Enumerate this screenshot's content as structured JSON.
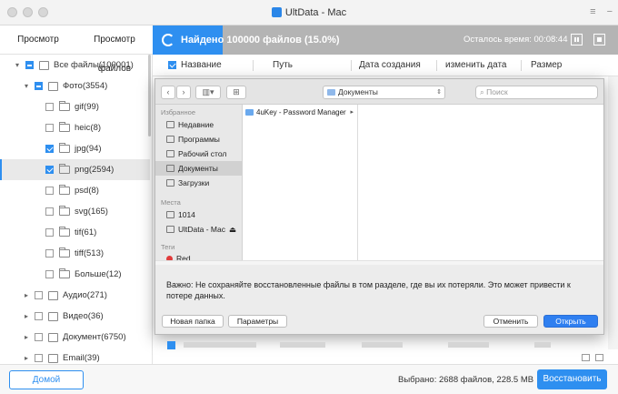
{
  "window": {
    "title": "UltData - Mac"
  },
  "tabs": [
    {
      "label": "Просмотр"
    },
    {
      "label": "Просмотр файлов"
    }
  ],
  "progress": {
    "text": "Найдено 100000 файлов (15.0%)",
    "percent": 15.0,
    "remaining": "Осталось время: 00:08:44"
  },
  "columns": {
    "name": "Название",
    "path": "Путь",
    "created": "Дата создания",
    "modified": "изменить дата",
    "size": "Размер"
  },
  "tree": [
    {
      "label": "Все файлы(100001)",
      "level": 0,
      "expanded": true,
      "check": "partial",
      "icon": "drive-icon"
    },
    {
      "label": "Фото(3554)",
      "level": 1,
      "expanded": true,
      "check": "partial",
      "icon": "photo-icon"
    },
    {
      "label": "gif(99)",
      "level": 2,
      "check": "unchecked",
      "icon": "folder-icon"
    },
    {
      "label": "heic(8)",
      "level": 2,
      "check": "unchecked",
      "icon": "folder-icon"
    },
    {
      "label": "jpg(94)",
      "level": 2,
      "check": "checked",
      "icon": "folder-icon"
    },
    {
      "label": "png(2594)",
      "level": 2,
      "check": "checked",
      "icon": "folder-icon",
      "selected": true
    },
    {
      "label": "psd(8)",
      "level": 2,
      "check": "unchecked",
      "icon": "folder-icon"
    },
    {
      "label": "svg(165)",
      "level": 2,
      "check": "unchecked",
      "icon": "folder-icon"
    },
    {
      "label": "tif(61)",
      "level": 2,
      "check": "unchecked",
      "icon": "folder-icon"
    },
    {
      "label": "tiff(513)",
      "level": 2,
      "check": "unchecked",
      "icon": "folder-icon"
    },
    {
      "label": "Больше(12)",
      "level": 2,
      "check": "unchecked",
      "icon": "folder-icon"
    },
    {
      "label": "Аудио(271)",
      "level": 1,
      "expanded": false,
      "check": "unchecked",
      "icon": "audio-icon"
    },
    {
      "label": "Видео(36)",
      "level": 1,
      "expanded": false,
      "check": "unchecked",
      "icon": "video-icon"
    },
    {
      "label": "Документ(6750)",
      "level": 1,
      "expanded": false,
      "check": "unchecked",
      "icon": "document-icon"
    },
    {
      "label": "Email(39)",
      "level": 1,
      "expanded": false,
      "check": "unchecked",
      "icon": "email-icon"
    }
  ],
  "dialog": {
    "location": "Документы",
    "search_placeholder": "Поиск",
    "favorites_header": "Избранное",
    "favorites": [
      {
        "label": "Недавние",
        "icon": "recent-icon"
      },
      {
        "label": "Программы",
        "icon": "applications-icon"
      },
      {
        "label": "Рабочий стол",
        "icon": "desktop-icon"
      },
      {
        "label": "Документы",
        "icon": "documents-icon",
        "selected": true
      },
      {
        "label": "Загрузки",
        "icon": "downloads-icon"
      }
    ],
    "places_header": "Места",
    "places": [
      {
        "label": "1014",
        "icon": "disk-icon"
      },
      {
        "label": "UltData - Mac",
        "icon": "disk-icon",
        "eject": "⏏"
      }
    ],
    "tags_header": "Теги",
    "tags": [
      {
        "label": "Red",
        "color": "#e03b3b"
      }
    ],
    "column_items": [
      {
        "label": "4uKey - Password Manager"
      }
    ],
    "notice": "Важно: Не сохраняйте восстановленные файлы в том разделе, где вы их потеряли. Это может привести к потере данных.",
    "buttons": {
      "new_folder": "Новая папка",
      "options": "Параметры",
      "cancel": "Отменить",
      "open": "Открыть"
    }
  },
  "bottom": {
    "home": "Домой",
    "selected": "Выбрано: 2688 файлов, 228.5 MB",
    "recover": "Восстановить"
  },
  "colors": {
    "accent": "#2e8ff0",
    "progress_track": "#b4b4b4"
  }
}
